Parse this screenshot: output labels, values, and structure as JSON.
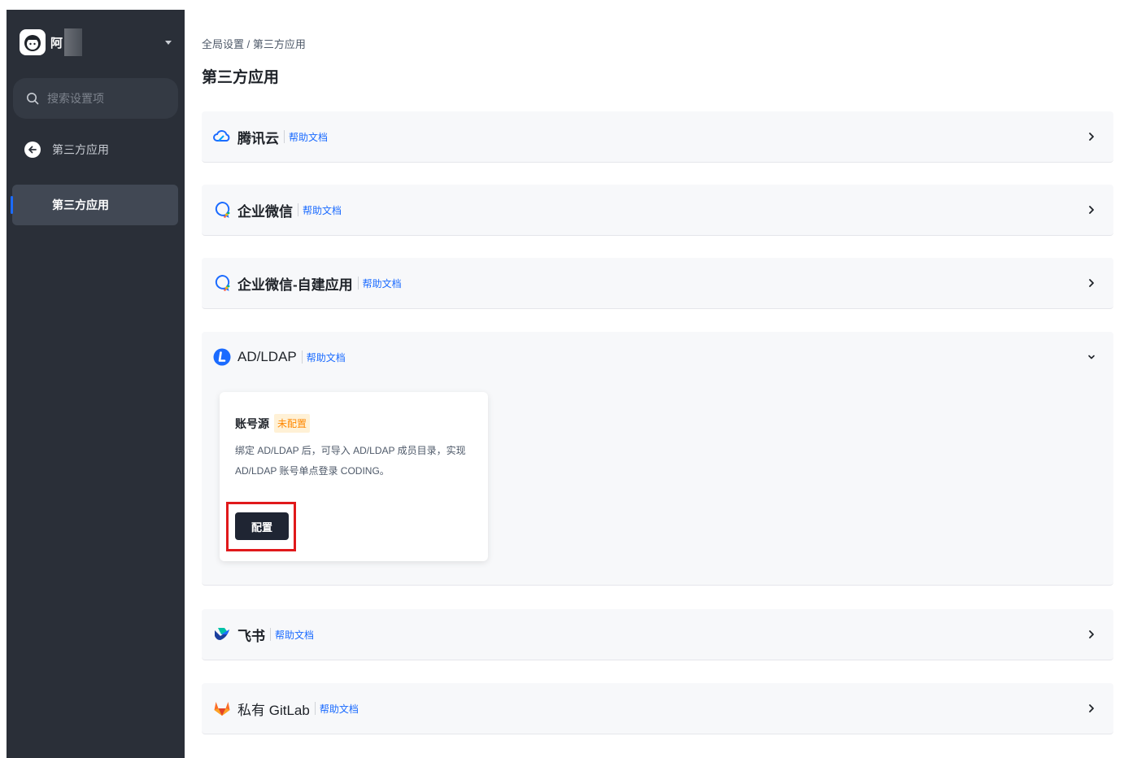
{
  "sidebar": {
    "team_name": "阿",
    "search_placeholder": "搜索设置项",
    "back_label": "第三方应用",
    "active_item": "第三方应用"
  },
  "main": {
    "breadcrumb": "全局设置 / 第三方应用",
    "title": "第三方应用",
    "help_label": "帮助文档",
    "integrations": [
      {
        "name": "腾讯云",
        "icon": "tencent-cloud-icon",
        "expanded": false
      },
      {
        "name": "企业微信",
        "icon": "wecom-icon",
        "expanded": false
      },
      {
        "name": "企业微信-自建应用",
        "icon": "wecom-icon",
        "expanded": false
      },
      {
        "name": "AD/LDAP",
        "icon": "ldap-icon",
        "expanded": true
      },
      {
        "name": "飞书",
        "icon": "feishu-icon",
        "expanded": false
      },
      {
        "name": "私有 GitLab",
        "icon": "gitlab-icon",
        "expanded": false
      }
    ],
    "ldap_panel": {
      "title": "账号源",
      "status": "未配置",
      "description": "绑定 AD/LDAP 后，可导入 AD/LDAP 成员目录，实现 AD/LDAP 账号单点登录 CODING。",
      "button_label": "配置"
    }
  },
  "colors": {
    "sidebar_bg": "#2a2f38",
    "accent": "#1b6bff",
    "badge_text": "#ff8800",
    "highlight": "#e0191b"
  }
}
